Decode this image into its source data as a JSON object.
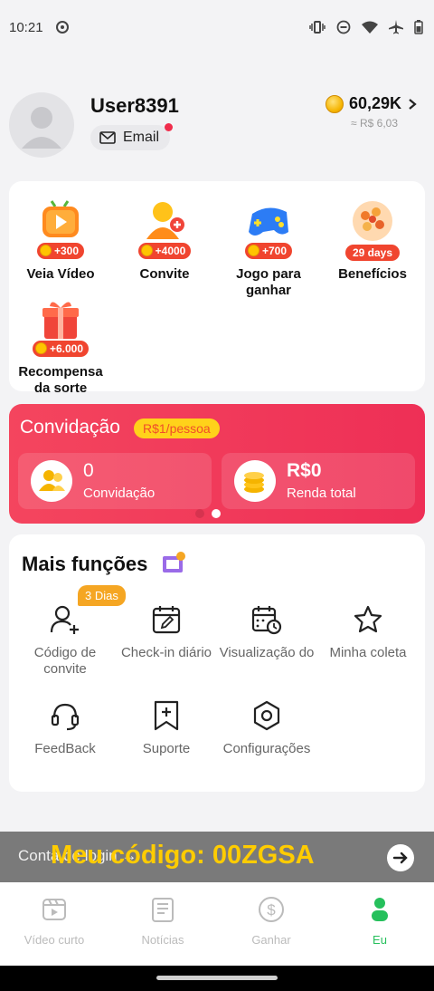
{
  "status_bar": {
    "time": "10:21"
  },
  "profile": {
    "username": "User8391",
    "email_label": "Email",
    "balance": "60,29K",
    "balance_sub": "≈ R$ 6,03"
  },
  "tasks": [
    {
      "label": "Veia Vídeo",
      "badge": "+300"
    },
    {
      "label": "Convite",
      "badge": "+4000"
    },
    {
      "label": "Jogo para ganhar",
      "badge": "+700"
    },
    {
      "label": "Benefícios",
      "badge": "29 days"
    },
    {
      "label": "Recompensa da sorte",
      "badge": "+6.000"
    }
  ],
  "invite": {
    "title": "Convidação",
    "pill": "R$1/pessoa",
    "stats": [
      {
        "value": "0",
        "caption": "Convidação"
      },
      {
        "value": "R$0",
        "caption": "Renda total"
      }
    ]
  },
  "more": {
    "title": "Mais funções",
    "days_badge": "3 Dias",
    "items": [
      {
        "label": "Código de convite",
        "icon": "user-add-icon"
      },
      {
        "label": "Check-in diário",
        "icon": "calendar-edit-icon"
      },
      {
        "label": "Visualização do",
        "icon": "calendar-clock-icon"
      },
      {
        "label": "Minha coleta",
        "icon": "star-icon"
      },
      {
        "label": "FeedBack",
        "icon": "headset-icon"
      },
      {
        "label": "Suporte",
        "icon": "bookmark-plus-icon"
      },
      {
        "label": "Configurações",
        "icon": "hexagon-gear-icon"
      }
    ]
  },
  "login_bar": {
    "text": "Conta de login →",
    "code": "Meu código: 00ZGSA"
  },
  "tabs": [
    {
      "label": "Vídeo curto"
    },
    {
      "label": "Notícias"
    },
    {
      "label": "Ganhar"
    },
    {
      "label": "Eu"
    }
  ],
  "colors": {
    "accent": "#26c05c",
    "invite_red": "#f23e5a",
    "badge_red": "#f0452f",
    "gold": "#ffcc00"
  }
}
